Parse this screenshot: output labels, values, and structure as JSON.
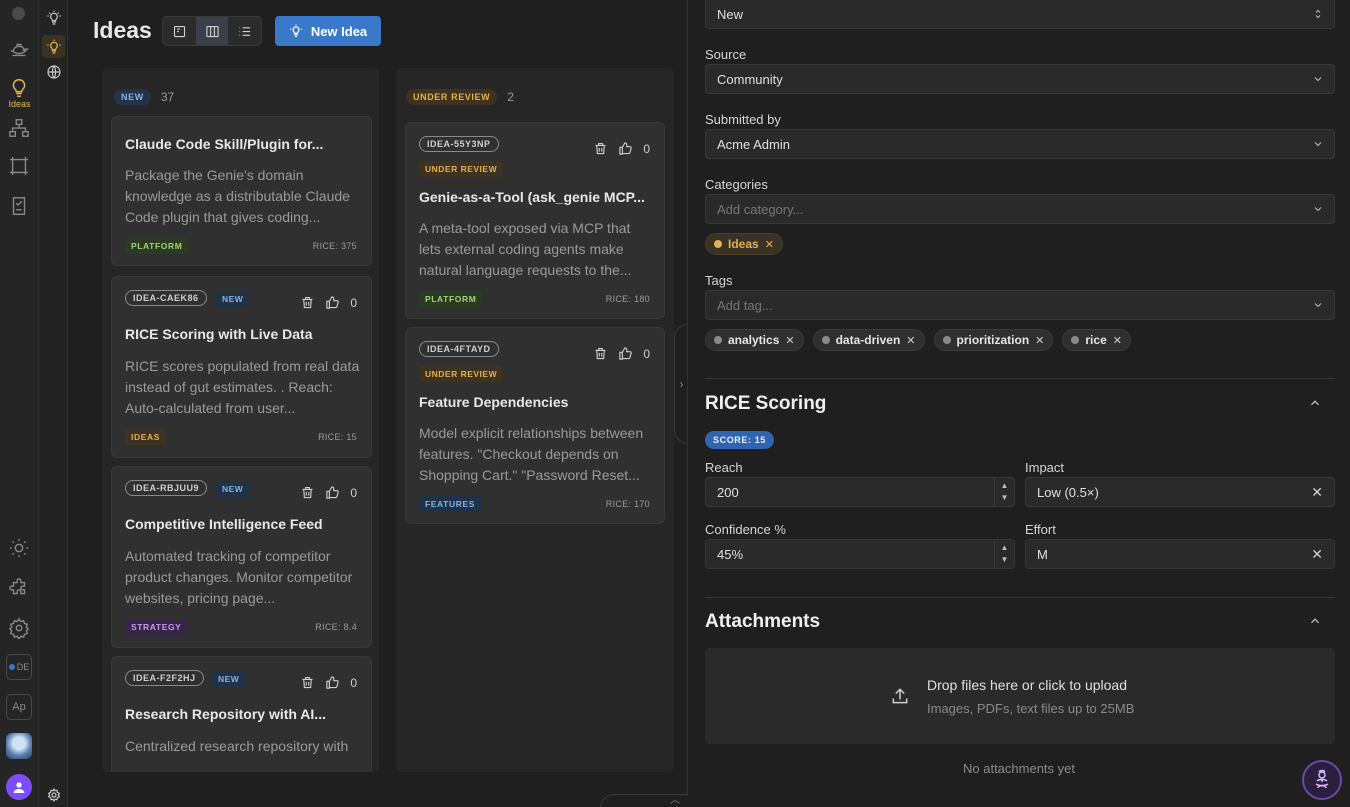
{
  "rail": {
    "ideas_label": "Ideas",
    "de_label": "DE",
    "ap_label": "Ap"
  },
  "header": {
    "title": "Ideas",
    "new_idea_label": "New Idea"
  },
  "columns": {
    "new": {
      "label": "NEW",
      "count": "37",
      "cards": [
        {
          "id": "",
          "status": "",
          "title": "Claude Code Skill/Plugin for...",
          "desc": "Package the Genie's domain knowledge as a distributable Claude Code plugin that gives coding...",
          "category": "PLATFORM",
          "rice": "RICE: 375",
          "votes": ""
        },
        {
          "id": "IDEA-CAEK86",
          "status": "NEW",
          "title": "RICE Scoring with Live Data",
          "desc": "RICE scores populated from real data instead of gut estimates. . Reach: Auto-calculated from user...",
          "category": "IDEAS",
          "rice": "RICE: 15",
          "votes": "0"
        },
        {
          "id": "IDEA-RBJUU9",
          "status": "NEW",
          "title": "Competitive Intelligence Feed",
          "desc": "Automated tracking of competitor product changes. Monitor competitor websites, pricing page...",
          "category": "STRATEGY",
          "rice": "RICE: 8.4",
          "votes": "0"
        },
        {
          "id": "IDEA-F2F2HJ",
          "status": "NEW",
          "title": "Research Repository with AI...",
          "desc": "Centralized research repository with",
          "category": "",
          "rice": "",
          "votes": "0"
        }
      ]
    },
    "review": {
      "label": "UNDER REVIEW",
      "count": "2",
      "cards": [
        {
          "id": "IDEA-55Y3NP",
          "status": "UNDER REVIEW",
          "title": "Genie-as-a-Tool (ask_genie MCP...",
          "desc": "A meta-tool exposed via MCP that lets external coding agents make natural language requests to the...",
          "category": "PLATFORM",
          "rice": "RICE: 180",
          "votes": "0"
        },
        {
          "id": "IDEA-4FTAYD",
          "status": "UNDER REVIEW",
          "title": "Feature Dependencies",
          "desc": "Model explicit relationships between features. \"Checkout depends on Shopping Cart.\" \"Password Reset...",
          "category": "FEATURES",
          "rice": "RICE: 170",
          "votes": "0"
        }
      ]
    }
  },
  "panel": {
    "status_value": "New",
    "source_label": "Source",
    "source_value": "Community",
    "submitted_label": "Submitted by",
    "submitted_value": "Acme Admin",
    "categories_label": "Categories",
    "categories_placeholder": "Add category...",
    "categories": [
      "Ideas"
    ],
    "tags_label": "Tags",
    "tags_placeholder": "Add tag...",
    "tags": [
      "analytics",
      "data-driven",
      "prioritization",
      "rice"
    ],
    "rice": {
      "title": "RICE Scoring",
      "score_label": "SCORE: 15",
      "reach_label": "Reach",
      "reach_value": "200",
      "impact_label": "Impact",
      "impact_value": "Low (0.5×)",
      "confidence_label": "Confidence %",
      "confidence_value": "45%",
      "effort_label": "Effort",
      "effort_value": "M"
    },
    "attachments": {
      "title": "Attachments",
      "drop_text": "Drop files here or click to upload",
      "drop_hint": "Images, PDFs, text files up to 25MB",
      "empty_text": "No attachments yet"
    }
  },
  "colors": {
    "accent": "#3a78c9",
    "gold": "#e2b052",
    "bg": "#1f1f1f"
  }
}
